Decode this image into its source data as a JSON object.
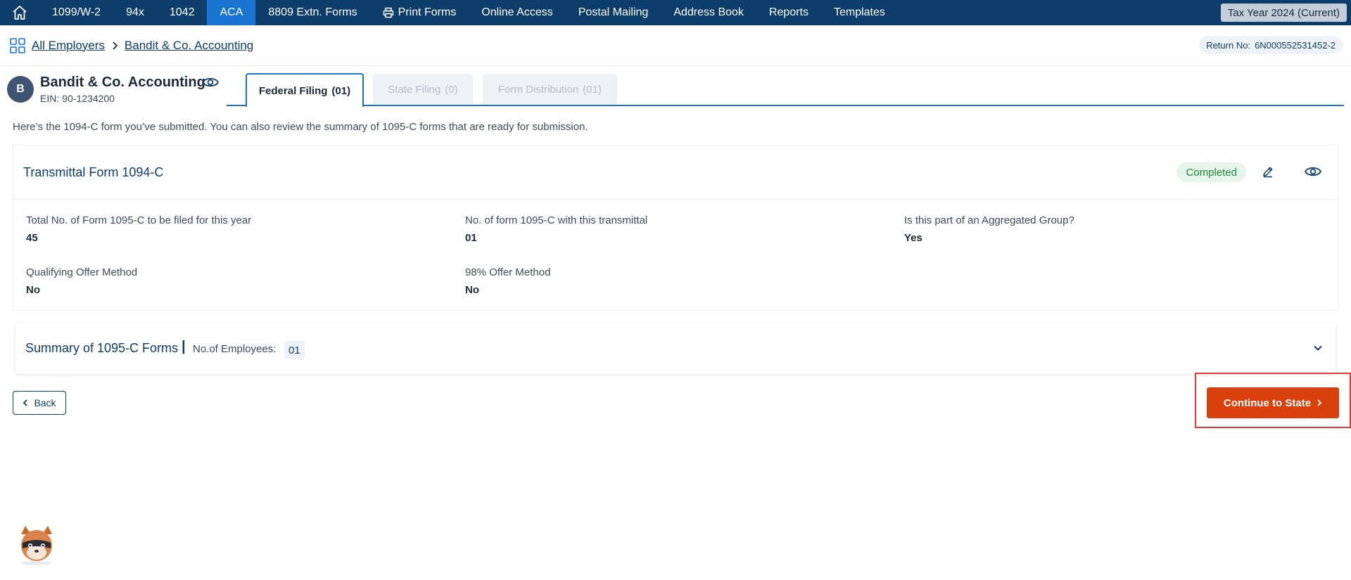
{
  "topnav": {
    "items": [
      {
        "label": "1099/W-2"
      },
      {
        "label": "94x"
      },
      {
        "label": "1042"
      },
      {
        "label": "ACA"
      },
      {
        "label": "8809 Extn. Forms"
      },
      {
        "label": "Print Forms"
      },
      {
        "label": "Online Access"
      },
      {
        "label": "Postal Mailing"
      },
      {
        "label": "Address Book"
      },
      {
        "label": "Reports"
      },
      {
        "label": "Templates"
      }
    ],
    "active": "ACA",
    "tax_year": "Tax Year 2024 (Current)"
  },
  "breadcrumb": {
    "root": "All Employers",
    "current": "Bandit & Co. Accounting"
  },
  "return_no": {
    "label": "Return No:",
    "value": "6N000552531452-2"
  },
  "employer": {
    "initial": "B",
    "name": "Bandit & Co. Accounting",
    "ein_label": "EIN:",
    "ein": "90-1234200"
  },
  "tabs": [
    {
      "label": "Federal Filing",
      "count": "(01)"
    },
    {
      "label": "State Filing",
      "count": "(0)"
    },
    {
      "label": "Form Distribution",
      "count": "(01)"
    }
  ],
  "intro": "Here’s the 1094-C form you’ve submitted. You can also review the summary of 1095-C forms that are ready for submission.",
  "transmittal": {
    "title": "Transmittal Form 1094-C",
    "status": "Completed",
    "fields": [
      {
        "label": "Total No. of Form 1095-C to be filed for this year",
        "value": "45"
      },
      {
        "label": "No. of form 1095-C with this transmittal",
        "value": "01"
      },
      {
        "label": "Is this part of an Aggregated Group?",
        "value": "Yes"
      },
      {
        "label": "Qualifying Offer Method",
        "value": "No"
      },
      {
        "label": "98% Offer Method",
        "value": "No"
      }
    ]
  },
  "summary": {
    "title": "Summary of 1095-C Forms",
    "separator": "|",
    "employees_label": "No.of Employees:",
    "employees_count": "01"
  },
  "buttons": {
    "back": "Back",
    "continue": "Continue to State"
  },
  "colors": {
    "nav_bg": "#0d3d6b",
    "nav_active": "#1a75d2",
    "continue_bg": "#d9400b",
    "completed_bg": "#e6f5ea",
    "completed_text": "#1f8a3b",
    "highlight": "#e53935"
  },
  "icons": {
    "home": "home-icon",
    "printer": "printer-icon",
    "grid": "grid-icon",
    "chevron_right": "chevron-right-icon",
    "eye": "eye-icon",
    "edit": "pencil-icon",
    "chevron_down": "chevron-down-icon",
    "chevron_left": "chevron-left-icon",
    "mascot": "raccoon-mascot-icon"
  }
}
